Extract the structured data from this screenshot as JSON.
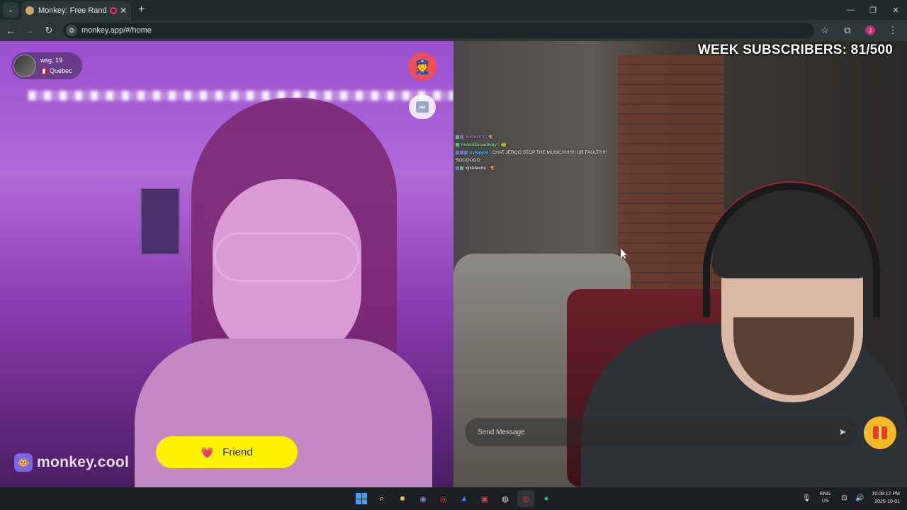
{
  "browser": {
    "tab_title": "Monkey: Free Random Vide",
    "new_tab": "+",
    "url": "monkey.app/#/home",
    "window_controls": [
      "—",
      "❐",
      "✕"
    ],
    "profile_initial": "J"
  },
  "left_panel": {
    "user": {
      "name_age": "wsg, 19",
      "location": "Quebec"
    },
    "brand": "monkey.cool",
    "friend_button": "Friend"
  },
  "right_panel": {
    "week_subscribers": "WEEK SUBSCRIBERS: 81/500",
    "chat": [
      {
        "user": "VictorVV",
        "message": "",
        "user_color": "#b86cff"
      },
      {
        "user": "InventBroadway",
        "message": "",
        "user_color": "#6fe07a"
      },
      {
        "user": "xylopylo",
        "message": ": CHAT JERQO STOP THE MUSIC!!!!!!!!!!! UR FAULT!!!!!! BOOOOOO",
        "user_color": "#59c4ff"
      },
      {
        "user": "xjxblackx",
        "message": "",
        "user_color": "#e0e0e0"
      }
    ],
    "message_placeholder": "Send Message"
  },
  "taskbar": {
    "language": [
      "ENG",
      "US"
    ],
    "time": "10:08:12 PM",
    "date": "2025-10-01"
  },
  "colors": {
    "friend_button": "#fff200",
    "report_button": "#f04d5a",
    "gift_button": "#f5b928"
  }
}
